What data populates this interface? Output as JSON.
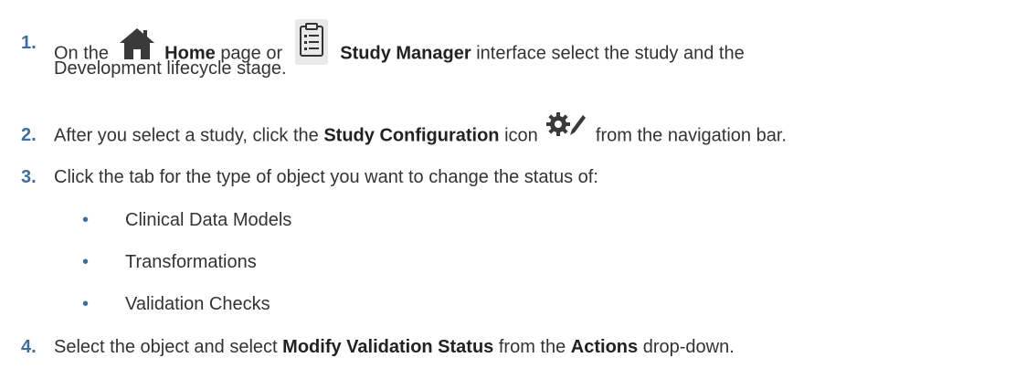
{
  "steps": [
    {
      "number": "1.",
      "parts": {
        "a": "On the",
        "home": "Home",
        "b": "page or",
        "study_manager": "Study Manager",
        "c": "interface select the study and the",
        "d": "Development lifecycle stage."
      }
    },
    {
      "number": "2.",
      "parts": {
        "a": "After you select a study, click the",
        "study_configuration": "Study Configuration",
        "b": "icon",
        "c": "from the navigation bar."
      }
    },
    {
      "number": "3.",
      "parts": {
        "a": "Click the tab for the type of object you want to change the status of:"
      },
      "bullets": [
        "Clinical Data Models",
        "Transformations",
        "Validation Checks"
      ]
    },
    {
      "number": "4.",
      "parts": {
        "a": "Select the object and select",
        "modify": "Modify Validation Status",
        "b": "from the",
        "actions": "Actions",
        "c": "drop-down."
      }
    }
  ],
  "bullet_glyph": "•",
  "icons": {
    "home": "home-icon",
    "study_manager": "clipboard-list-icon",
    "study_configuration": "gear-pencil-icon"
  },
  "colors": {
    "step_number": "#3f6d9f",
    "text": "#333333",
    "icon": "#3a3a3a"
  }
}
